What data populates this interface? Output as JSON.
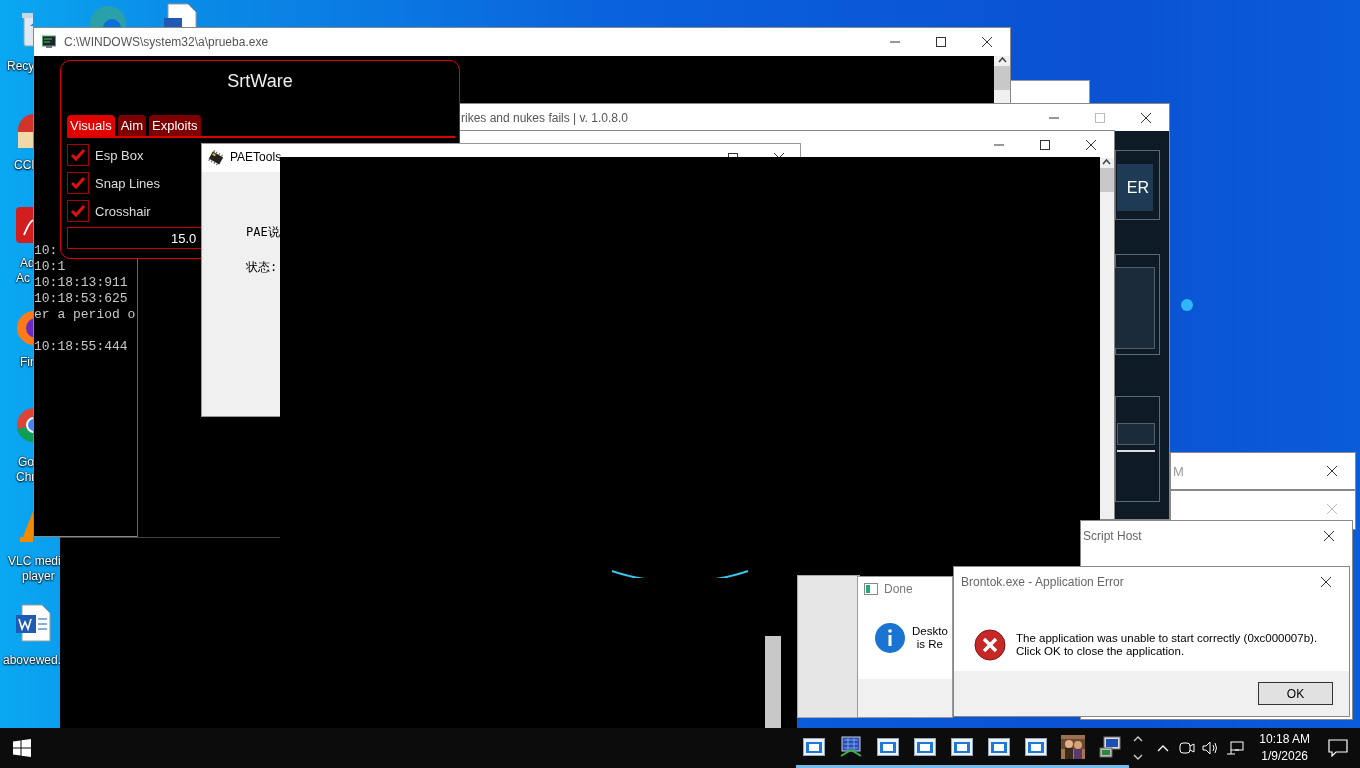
{
  "desktop": {
    "top_icons": [
      {
        "kind": "edge"
      },
      {
        "kind": "document"
      }
    ],
    "icons": [
      {
        "kind": "recycle",
        "lines": [
          "Recy"
        ]
      },
      {
        "kind": "ccleaner",
        "lines": [
          "CCI"
        ]
      },
      {
        "kind": "acrobat",
        "lines": [
          "Ad",
          "Ac"
        ]
      },
      {
        "kind": "firefox",
        "lines": [
          "Fir"
        ]
      },
      {
        "kind": "chrome",
        "lines": [
          "Go",
          "Chr"
        ]
      },
      {
        "kind": "vlc",
        "lines": [
          "VLC medi",
          "player"
        ]
      },
      {
        "kind": "word",
        "lines": [
          "abovewed."
        ]
      }
    ]
  },
  "console": {
    "title": "C:\\WINDOWS\\system32\\a\\prueba.exe",
    "lines": [
      "10:",
      "10:1",
      "10:18:13:911",
      "10:18:53:625",
      "er a period o"
    ],
    "lines_after_blank": [
      "10:18:55:444"
    ]
  },
  "rear_window": {
    "title": "rikes and nukes fails | v. 1.0.8.0",
    "button": "ER"
  },
  "cheat_menu": {
    "title": "SrtWare",
    "tabs": [
      {
        "label": "Visuals",
        "selected": true
      },
      {
        "label": "Aim",
        "selected": false
      },
      {
        "label": "Exploits",
        "selected": false
      }
    ],
    "options": [
      {
        "label": "Esp Box",
        "checked": true
      },
      {
        "label": "Snap Lines",
        "checked": true
      },
      {
        "label": "Crosshair",
        "checked": true
      }
    ],
    "value": "15.0"
  },
  "pae_tools": {
    "title": "PAETools",
    "labels": [
      "PAE说",
      "状态:"
    ]
  },
  "m_window": {
    "title": "M"
  },
  "script_host": {
    "title": "Script Host"
  },
  "done_dialog": {
    "title": "Done",
    "lines": [
      "Deskto",
      "is Re"
    ]
  },
  "error_dialog": {
    "title": "Brontok.exe - Application Error",
    "message_lines": [
      "The application was unable to start correctly (0xc000007b).",
      "Click OK to close the application."
    ],
    "button": "OK"
  },
  "taskbar": {
    "apps": [
      {
        "kind": "window"
      },
      {
        "kind": "network"
      },
      {
        "kind": "window"
      },
      {
        "kind": "window"
      },
      {
        "kind": "window"
      },
      {
        "kind": "window"
      },
      {
        "kind": "window"
      },
      {
        "kind": "picture"
      },
      {
        "kind": "computer"
      }
    ],
    "time": "10:18 AM",
    "date": "1/9/2026"
  }
}
